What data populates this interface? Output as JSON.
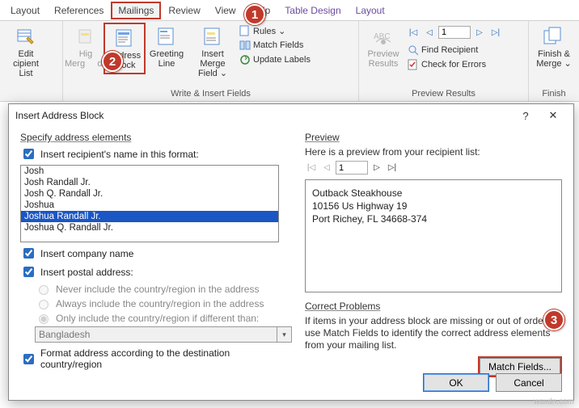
{
  "tabs": {
    "layout1": "Layout",
    "references": "References",
    "mailings": "Mailings",
    "review": "Review",
    "view": "View",
    "help": "Help",
    "tabledesign": "Table Design",
    "layout2": "Layout"
  },
  "ribbon": {
    "edit_recip": "Edit\nRecipient List",
    "edit_recip1": "Edit",
    "edit_recip2": "cipient List",
    "highlight1": "Hig",
    "highlight2": "Merg",
    "highlight3": "ds",
    "address1": "Address",
    "address2": "Block",
    "greeting1": "Greeting",
    "greeting2": "Line",
    "insertmerge1": "Insert Merge",
    "insertmerge2": "Field ⌄",
    "rules": "Rules ⌄",
    "matchfields": "Match Fields",
    "updatelabels": "Update Labels",
    "preview1": "Preview",
    "preview2": "Results",
    "nav_value": "1",
    "findrecip": "Find Recipient",
    "checkerrors": "Check for Errors",
    "finish1": "Finish &",
    "finish2": "Merge ⌄",
    "grp_write": "Write & Insert Fields",
    "grp_preview": "Preview Results",
    "grp_finish": "Finish"
  },
  "dialog": {
    "title": "Insert Address Block",
    "specify": "Specify address elements",
    "insert_name": "Insert recipient's name in this format:",
    "names": {
      "n0": "Josh",
      "n1": "Josh Randall Jr.",
      "n2": "Josh Q. Randall Jr.",
      "n3": "Joshua",
      "n4": "Joshua Randall Jr.",
      "n5": "Joshua Q. Randall Jr."
    },
    "insert_company": "Insert company name",
    "insert_postal": "Insert postal address:",
    "r_never": "Never include the country/region in the address",
    "r_always": "Always include the country/region in the address",
    "r_only": "Only include the country/region if different than:",
    "country": "Bangladesh",
    "format_dest": "Format address according to the destination country/region",
    "preview": "Preview",
    "preview_hint": "Here is a preview from your recipient list:",
    "preview_nav_value": "1",
    "addr_l1": "Outback Steakhouse",
    "addr_l2": "10156 Us Highway 19",
    "addr_l3": "Port Richey, FL 34668-374",
    "correct": "Correct Problems",
    "correct_text": "If items in your address block are missing or out of order, use Match Fields to identify the correct address elements from your mailing list.",
    "match_btn": "Match Fields...",
    "ok": "OK",
    "cancel": "Cancel"
  },
  "badges": {
    "b1": "1",
    "b2": "2",
    "b3": "3"
  },
  "watermark": "wsxdn.com"
}
